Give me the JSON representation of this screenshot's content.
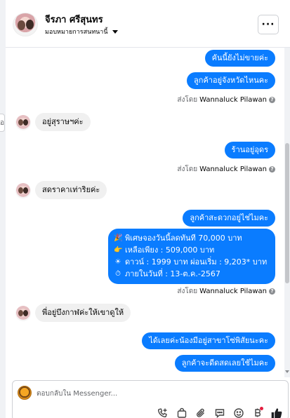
{
  "header": {
    "contact_name": "จีรภา ศรีสุนทร",
    "assign_label": "มอบหมายการสนทนานี้",
    "more_label": "···"
  },
  "left_tab_label": "อ",
  "messages": {
    "out_1": "คันนี้ยังไม่ขายค่ะ",
    "out_2": "ลูกค้าอยู่จังหวัดไหนคะ",
    "sent_by_prefix": "ส่งโดย",
    "sender_name": "Wannaluck Pilawan",
    "in_1": "อยู่สุราษฯค่ะ",
    "out_3": "ร้านอยู่อุดร",
    "in_2": "สดราคาเท่าริยค่ะ",
    "out_4": "ลูกค้าสะดวกอยู่ไช่ไมคะ",
    "promo_lines": [
      {
        "emoji": "🎉",
        "text": "พิเศษจองวันนี้ลดทันที 70,000 บาท"
      },
      {
        "emoji": "👉",
        "text": "เหลือเพียง : 509,000 บาท"
      },
      {
        "emoji": "☀",
        "text": "ดาวน์ : 1999 บาท ผ่อนเริ่ม : 9,203* บาท"
      },
      {
        "emoji": "⏱",
        "text": "ภายในวันที่ : 13-ต.ค.-2567"
      }
    ],
    "in_3": "พี่อยู่บึงกาฬค่ะให้เขาดูให้",
    "out_5": "ได้เลยค่ะน้องมีอยู่สาขาโซ่พิสัยนะคะ",
    "out_6": "ลูกค้าจะดีดสดเลยใช้ไมคะ"
  },
  "composer": {
    "placeholder": "ตอบกลับใน Messenger..."
  },
  "icons": [
    "phone-plus-icon",
    "bag-icon",
    "paperclip-icon",
    "chat-bubble-icon",
    "smile-icon",
    "baht-icon",
    "thumbs-up-icon"
  ],
  "colors": {
    "bubble_out": "#0a7cff",
    "bubble_in": "#f0f0f0",
    "notification_dot": "#e41e3f"
  }
}
